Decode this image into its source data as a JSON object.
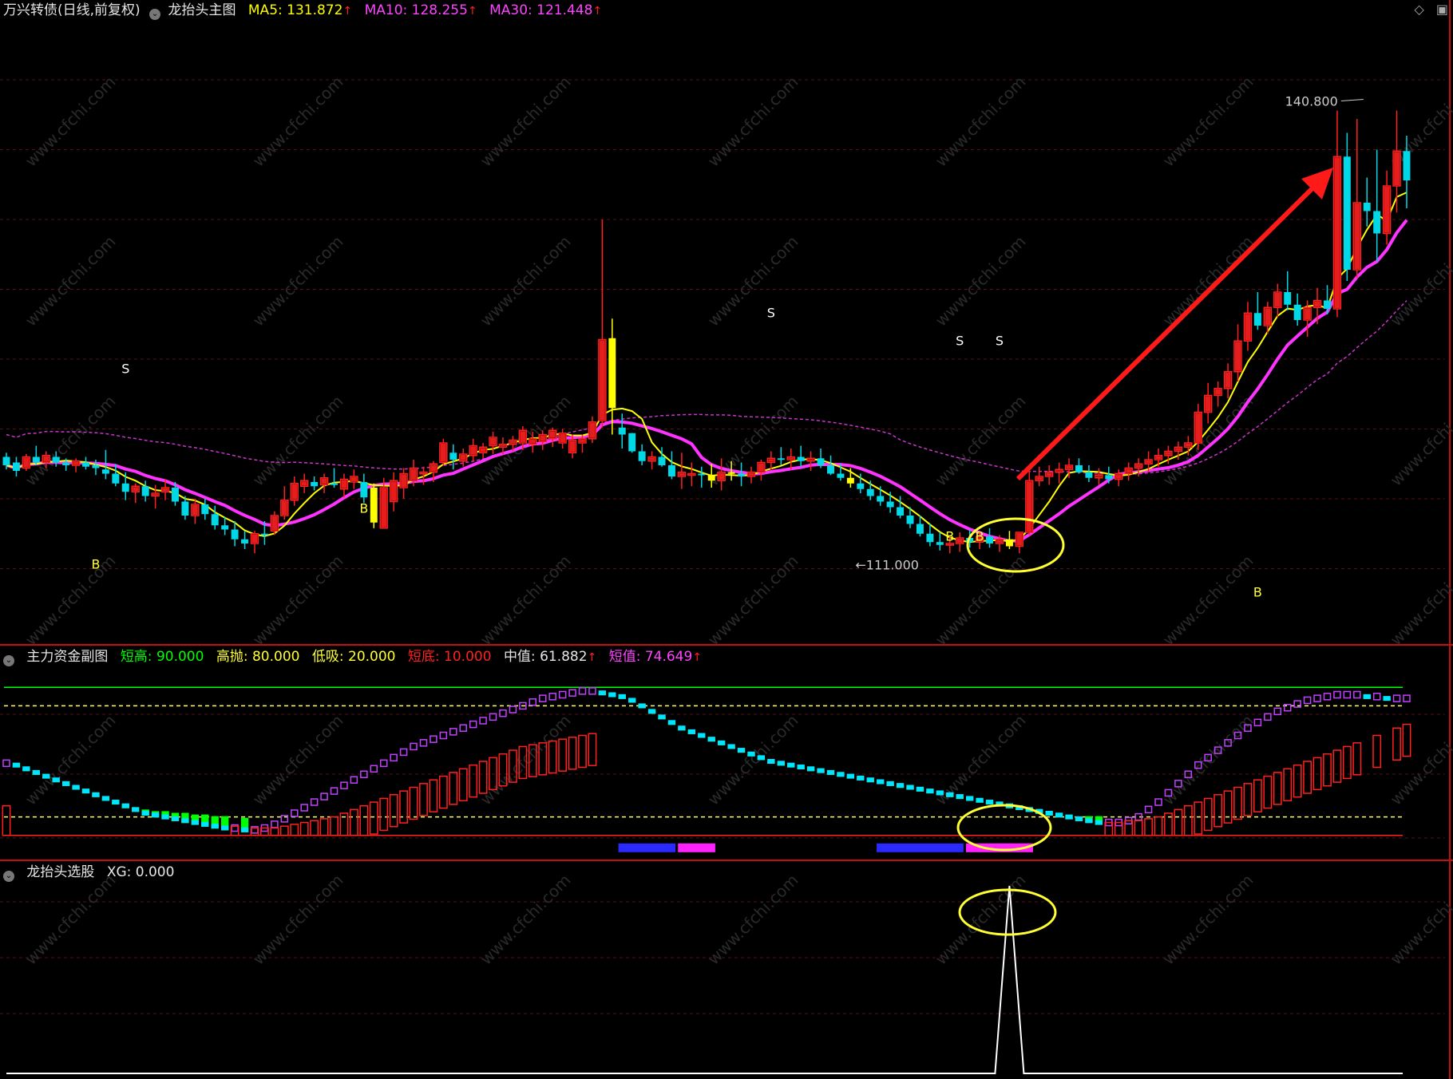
{
  "colors": {
    "ma5": "#ffff00",
    "ma10": "#ff33ff",
    "ma30": "#cc33cc",
    "up": "#ff2020",
    "down": "#00d8e8",
    "signal": "#ffff00",
    "grid": "#5a1010",
    "arrow": "#ff1a1a",
    "ellipse": "#ffff33",
    "green_bar": "#00ff00",
    "cyan_bar": "#00e5ff",
    "purple_line": "#c040ff",
    "red_hollow": "#ff2020",
    "line_high": "#00ff00",
    "line_sell": "#ffff66",
    "line_low": "#ffff66",
    "line_bottom": "#ff2020",
    "xg_line": "#ffffff"
  },
  "main": {
    "security": "万兴转债(日线,前复权)",
    "indicator": "龙抬头主图",
    "ma5_label": "MA5: 131.872",
    "ma10_label": "MA10: 128.255",
    "ma30_label": "MA30: 121.448",
    "up_mark": "↑",
    "high_label": "140.800",
    "low_label": "111.000",
    "toggle_icon": "chevron-down-icon"
  },
  "sub": {
    "indicator": "主力资金副图",
    "short_high": "短高: 90.000",
    "high_sell": "高抛: 80.000",
    "low_buy": "低吸: 20.000",
    "short_bottom": "短底: 10.000",
    "median": "中值: 61.882",
    "short_value": "短值: 74.649",
    "up_mark": "↑"
  },
  "xg": {
    "indicator": "龙抬头选股",
    "xg_label": "XG: 0.000"
  },
  "watermark": "www.cfchi.com",
  "chart_data": [
    {
      "type": "candlestick",
      "title": "龙抬头主图",
      "ylim": [
        103,
        147
      ],
      "series": [
        {
          "name": "MA5",
          "value": 131.872
        },
        {
          "name": "MA10",
          "value": 128.255
        },
        {
          "name": "MA30",
          "value": 121.448
        }
      ],
      "ohlc": [
        [
          116.0,
          116.3,
          115.1,
          115.4
        ],
        [
          115.6,
          116.0,
          114.6,
          115.0
        ],
        [
          115.2,
          116.2,
          115.0,
          116.0
        ],
        [
          116.0,
          116.8,
          115.4,
          115.6
        ],
        [
          115.6,
          116.4,
          115.2,
          116.1
        ],
        [
          116.0,
          116.4,
          115.3,
          115.6
        ],
        [
          115.6,
          115.9,
          115.0,
          115.4
        ],
        [
          115.4,
          115.9,
          114.9,
          115.7
        ],
        [
          115.6,
          116.0,
          115.1,
          115.3
        ],
        [
          115.4,
          115.8,
          114.7,
          115.2
        ],
        [
          115.1,
          116.5,
          114.4,
          114.8
        ],
        [
          114.8,
          115.5,
          113.9,
          114.1
        ],
        [
          114.1,
          114.9,
          112.9,
          113.5
        ],
        [
          113.5,
          114.1,
          112.7,
          113.9
        ],
        [
          113.9,
          114.3,
          112.8,
          113.2
        ],
        [
          113.2,
          114.0,
          112.3,
          113.4
        ],
        [
          113.5,
          114.4,
          112.9,
          113.8
        ],
        [
          113.8,
          114.2,
          112.5,
          112.8
        ],
        [
          112.8,
          113.2,
          111.5,
          111.8
        ],
        [
          111.8,
          113.0,
          111.2,
          112.6
        ],
        [
          112.6,
          113.0,
          111.5,
          111.9
        ],
        [
          111.9,
          112.5,
          110.8,
          111.1
        ],
        [
          111.1,
          111.7,
          110.4,
          110.8
        ],
        [
          110.8,
          111.4,
          109.6,
          110.1
        ],
        [
          110.1,
          110.7,
          109.4,
          109.8
        ],
        [
          109.8,
          110.7,
          109.1,
          110.5
        ],
        [
          110.5,
          111.4,
          109.7,
          110.4
        ],
        [
          110.7,
          112.1,
          110.4,
          111.8
        ],
        [
          111.8,
          113.9,
          111.5,
          112.9
        ],
        [
          112.9,
          114.6,
          112.5,
          114.1
        ],
        [
          113.9,
          114.8,
          113.4,
          114.3
        ],
        [
          114.2,
          114.6,
          113.6,
          113.9
        ],
        [
          114.0,
          114.8,
          113.4,
          114.5
        ],
        [
          114.1,
          115.2,
          113.8,
          114.0
        ],
        [
          113.7,
          114.8,
          113.1,
          114.4
        ],
        [
          114.2,
          115.1,
          113.7,
          114.6
        ],
        [
          114.2,
          114.8,
          112.7,
          113.1
        ],
        [
          111.3,
          114.1,
          110.9,
          113.8
        ],
        [
          110.9,
          114.5,
          110.9,
          113.8
        ],
        [
          112.8,
          114.9,
          112.1,
          114.3
        ],
        [
          113.8,
          115.2,
          113.0,
          114.8
        ],
        [
          114.3,
          115.8,
          113.9,
          115.2
        ],
        [
          114.8,
          115.3,
          114.0,
          114.9
        ],
        [
          114.9,
          115.7,
          114.2,
          115.5
        ],
        [
          115.6,
          117.3,
          115.4,
          117.0
        ],
        [
          116.3,
          116.9,
          115.1,
          115.8
        ],
        [
          115.7,
          116.6,
          115.3,
          116.2
        ],
        [
          116.1,
          117.3,
          115.7,
          116.8
        ],
        [
          116.3,
          117.0,
          115.9,
          116.7
        ],
        [
          116.8,
          117.8,
          116.2,
          117.4
        ],
        [
          116.7,
          117.4,
          116.2,
          116.9
        ],
        [
          116.9,
          117.5,
          116.4,
          117.2
        ],
        [
          117.0,
          118.2,
          116.5,
          117.9
        ],
        [
          116.9,
          117.8,
          116.3,
          117.3
        ],
        [
          117.1,
          117.9,
          116.5,
          117.6
        ],
        [
          117.3,
          118.1,
          116.7,
          117.9
        ],
        [
          117.0,
          118.0,
          116.6,
          117.7
        ],
        [
          116.3,
          117.6,
          115.9,
          117.2
        ],
        [
          117.0,
          117.6,
          116.3,
          117.3
        ],
        [
          117.3,
          118.9,
          117.0,
          118.5
        ],
        [
          118.6,
          133.0,
          118.1,
          124.4
        ],
        [
          124.5,
          125.9,
          117.6,
          119.5
        ],
        [
          118.1,
          119.1,
          116.6,
          117.6
        ],
        [
          117.7,
          117.7,
          116.3,
          116.4
        ],
        [
          116.4,
          116.9,
          115.4,
          115.7
        ],
        [
          115.7,
          116.4,
          115.1,
          116.0
        ],
        [
          116.0,
          116.7,
          115.3,
          115.4
        ],
        [
          115.4,
          116.4,
          114.4,
          114.6
        ],
        [
          114.6,
          116.3,
          113.7,
          114.9
        ],
        [
          114.8,
          115.6,
          113.9,
          114.8
        ],
        [
          114.8,
          115.3,
          113.8,
          114.7
        ],
        [
          114.7,
          115.5,
          113.8,
          114.3
        ],
        [
          114.3,
          115.9,
          113.6,
          114.9
        ],
        [
          114.9,
          115.7,
          114.3,
          114.8
        ],
        [
          114.8,
          115.6,
          113.9,
          114.6
        ],
        [
          114.6,
          115.3,
          114.1,
          114.9
        ],
        [
          114.9,
          115.8,
          114.3,
          115.6
        ],
        [
          115.6,
          116.4,
          115.1,
          115.9
        ],
        [
          115.9,
          116.7,
          115.4,
          115.8
        ],
        [
          115.8,
          116.6,
          115.1,
          116.0
        ],
        [
          116.0,
          116.8,
          115.3,
          115.7
        ],
        [
          115.7,
          116.4,
          115.0,
          115.9
        ],
        [
          115.9,
          116.6,
          115.2,
          115.4
        ],
        [
          115.4,
          116.1,
          114.7,
          114.8
        ],
        [
          114.8,
          115.5,
          114.3,
          114.5
        ],
        [
          114.5,
          115.2,
          113.8,
          114.1
        ],
        [
          114.1,
          114.8,
          113.4,
          113.7
        ],
        [
          113.7,
          114.3,
          112.9,
          113.2
        ],
        [
          113.2,
          113.9,
          112.5,
          112.8
        ],
        [
          112.8,
          113.5,
          112.0,
          112.4
        ],
        [
          112.4,
          113.2,
          111.6,
          111.8
        ],
        [
          111.8,
          112.4,
          110.9,
          111.2
        ],
        [
          111.2,
          111.8,
          110.3,
          110.5
        ],
        [
          110.5,
          111.2,
          109.6,
          109.9
        ],
        [
          109.9,
          110.6,
          109.3,
          109.7
        ],
        [
          109.7,
          110.3,
          109.1,
          109.8
        ],
        [
          109.8,
          110.6,
          109.2,
          110.2
        ],
        [
          110.2,
          110.8,
          109.5,
          109.9
        ],
        [
          109.9,
          110.6,
          109.4,
          110.3
        ],
        [
          110.3,
          110.9,
          109.5,
          109.8
        ],
        [
          109.8,
          110.4,
          109.2,
          110.1
        ],
        [
          110.1,
          110.7,
          109.4,
          109.6
        ],
        [
          109.6,
          110.5,
          109.1,
          110.6
        ],
        [
          110.6,
          115.0,
          110.4,
          114.3
        ],
        [
          114.3,
          115.3,
          113.9,
          114.6
        ],
        [
          114.6,
          115.4,
          114.0,
          114.9
        ],
        [
          114.9,
          115.6,
          114.1,
          115.1
        ],
        [
          115.1,
          115.9,
          114.5,
          115.4
        ],
        [
          115.4,
          115.9,
          114.8,
          114.9
        ],
        [
          114.9,
          115.4,
          114.2,
          114.5
        ],
        [
          114.5,
          115.2,
          114.0,
          114.7
        ],
        [
          114.7,
          115.3,
          114.1,
          114.4
        ],
        [
          114.4,
          115.1,
          113.9,
          114.8
        ],
        [
          114.8,
          115.6,
          114.3,
          115.2
        ],
        [
          115.2,
          115.9,
          114.6,
          115.5
        ],
        [
          115.5,
          116.4,
          114.9,
          115.8
        ],
        [
          115.8,
          116.6,
          115.3,
          116.1
        ],
        [
          116.1,
          116.8,
          115.5,
          116.4
        ],
        [
          116.4,
          117.1,
          115.8,
          116.7
        ],
        [
          116.7,
          117.5,
          116.1,
          117.0
        ],
        [
          117.0,
          119.8,
          116.5,
          119.2
        ],
        [
          119.2,
          121.3,
          118.4,
          120.4
        ],
        [
          120.4,
          121.4,
          119.6,
          120.9
        ],
        [
          120.9,
          122.7,
          120.2,
          122.1
        ],
        [
          122.1,
          125.5,
          121.4,
          124.3
        ],
        [
          124.3,
          127.1,
          123.6,
          126.3
        ],
        [
          126.3,
          127.8,
          125.1,
          125.4
        ],
        [
          125.4,
          127.1,
          124.8,
          126.7
        ],
        [
          126.7,
          128.4,
          126.0,
          127.8
        ],
        [
          127.8,
          129.3,
          126.5,
          126.9
        ],
        [
          126.9,
          127.7,
          125.4,
          125.8
        ],
        [
          125.8,
          127.2,
          124.6,
          126.7
        ],
        [
          126.7,
          128.1,
          125.5,
          127.2
        ],
        [
          127.2,
          128.3,
          126.2,
          126.6
        ],
        [
          126.6,
          140.8,
          126.0,
          137.5
        ],
        [
          137.5,
          139.2,
          128.6,
          129.4
        ],
        [
          129.4,
          140.2,
          128.8,
          134.2
        ],
        [
          134.2,
          136.0,
          132.5,
          133.6
        ],
        [
          133.6,
          138.0,
          130.0,
          132.0
        ],
        [
          132.0,
          136.5,
          131.2,
          135.4
        ],
        [
          135.4,
          140.8,
          133.5,
          137.9
        ],
        [
          137.9,
          139.0,
          133.8,
          135.8
        ]
      ]
    },
    {
      "type": "bar",
      "title": "主力资金副图",
      "ylim": [
        0,
        100
      ],
      "levels": {
        "短高": 90,
        "高抛": 80,
        "低吸": 20,
        "短底": 10
      },
      "series": [
        {
          "name": "中值",
          "value": 61.882
        },
        {
          "name": "短值",
          "value": 74.649
        }
      ],
      "fast": [
        49,
        48,
        46,
        44,
        42,
        40,
        38,
        36,
        34,
        32,
        30,
        28,
        26,
        24,
        22,
        21,
        20,
        19,
        18,
        17,
        16,
        15,
        14,
        14,
        13,
        13,
        14,
        16,
        19,
        22,
        25,
        28,
        31,
        34,
        37,
        40,
        43,
        46,
        49,
        52,
        55,
        58,
        60,
        62,
        64,
        66,
        68,
        70,
        72,
        74,
        76,
        78,
        80,
        82,
        84,
        85,
        86,
        87,
        88,
        88,
        87,
        86,
        85,
        83,
        80,
        77,
        74,
        71,
        68,
        66,
        64,
        62,
        60,
        58,
        56,
        54,
        52,
        50,
        49,
        48,
        47,
        46,
        45,
        44,
        43,
        42,
        41,
        40,
        39,
        38,
        37,
        36,
        35,
        34,
        33,
        32,
        31,
        30,
        29,
        28,
        27,
        26,
        25,
        24,
        23,
        22,
        21,
        20,
        19,
        18,
        17,
        17,
        17,
        18,
        20,
        24,
        28,
        33,
        38,
        43,
        48,
        52,
        56,
        60,
        64,
        68,
        71,
        74,
        77,
        79,
        81,
        83,
        84,
        85,
        86,
        86,
        86,
        85,
        85,
        84,
        84,
        84
      ],
      "slow": [
        26,
        26,
        26,
        25,
        25,
        24,
        24,
        23,
        23,
        22,
        22,
        21,
        21,
        20,
        20,
        19,
        19,
        18,
        18,
        17,
        17,
        16,
        16,
        15,
        15,
        14,
        14,
        14,
        15,
        16,
        17,
        18,
        19,
        20,
        22,
        24,
        26,
        28,
        30,
        32,
        34,
        36,
        38,
        40,
        42,
        44,
        46,
        48,
        50,
        52,
        54,
        56,
        58,
        59,
        60,
        61,
        62,
        63,
        64,
        65,
        64,
        62,
        59,
        56,
        53,
        50,
        48,
        46,
        44,
        43,
        42,
        41,
        40,
        39,
        38,
        37,
        36,
        35,
        34,
        33,
        32,
        31,
        30,
        29,
        28,
        27,
        26,
        25,
        24,
        23,
        22,
        21,
        20,
        19,
        18,
        17,
        16,
        15,
        14,
        14,
        13,
        13,
        12,
        12,
        12,
        12,
        13,
        14,
        15,
        16,
        16,
        17,
        17,
        18,
        18,
        19,
        20,
        22,
        24,
        26,
        28,
        30,
        32,
        34,
        36,
        38,
        40,
        42,
        44,
        46,
        48,
        50,
        52,
        54,
        56,
        58,
        60,
        62,
        64,
        66,
        68,
        70
      ],
      "zones": [
        {
          "from": 62,
          "to": 67,
          "label": "blue"
        },
        {
          "from": 68,
          "to": 71,
          "label": "magenta"
        },
        {
          "from": 88,
          "to": 96,
          "label": "blue"
        },
        {
          "from": 97,
          "to": 103,
          "label": "magenta"
        }
      ]
    },
    {
      "type": "line",
      "title": "龙抬头选股",
      "ylim": [
        0,
        1
      ],
      "series": [
        {
          "name": "XG",
          "value": 0,
          "spike_at": 101,
          "spike_value": 1
        }
      ]
    }
  ]
}
